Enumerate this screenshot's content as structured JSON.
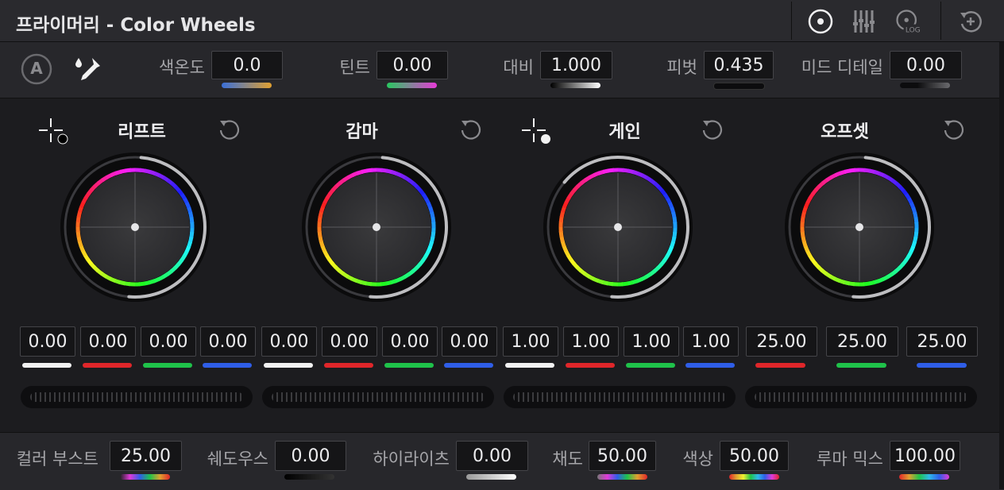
{
  "header": {
    "title": "프라이머리 - Color Wheels",
    "icons": [
      "wheels-mode-icon",
      "bars-mode-icon",
      "log-mode-icon",
      "reset-all-icon"
    ],
    "log_label": "LOG"
  },
  "primaries": {
    "auto_label": "A",
    "params": [
      {
        "label": "색온도",
        "value": "0.0"
      },
      {
        "label": "틴트",
        "value": "0.00"
      },
      {
        "label": "대비",
        "value": "1.000"
      },
      {
        "label": "피벗",
        "value": "0.435"
      },
      {
        "label": "미드 디테일",
        "value": "0.00"
      }
    ]
  },
  "wheels": [
    {
      "name": "리프트",
      "values": [
        "0.00",
        "0.00",
        "0.00",
        "0.00"
      ]
    },
    {
      "name": "감마",
      "values": [
        "0.00",
        "0.00",
        "0.00",
        "0.00"
      ]
    },
    {
      "name": "게인",
      "values": [
        "1.00",
        "1.00",
        "1.00",
        "1.00"
      ]
    },
    {
      "name": "오프셋",
      "values": [
        "25.00",
        "25.00",
        "25.00"
      ]
    }
  ],
  "bottom": {
    "params": [
      {
        "label": "컬러 부스트",
        "value": "25.00"
      },
      {
        "label": "쉐도우스",
        "value": "0.00"
      },
      {
        "label": "하이라이츠",
        "value": "0.00"
      },
      {
        "label": "채도",
        "value": "50.00"
      },
      {
        "label": "색상",
        "value": "50.00"
      },
      {
        "label": "루마 믹스",
        "value": "100.00"
      }
    ]
  },
  "colors": {
    "red": "#e0262a",
    "green": "#1fc24a",
    "blue": "#2f5ee8",
    "white": "#f2f2f2"
  }
}
